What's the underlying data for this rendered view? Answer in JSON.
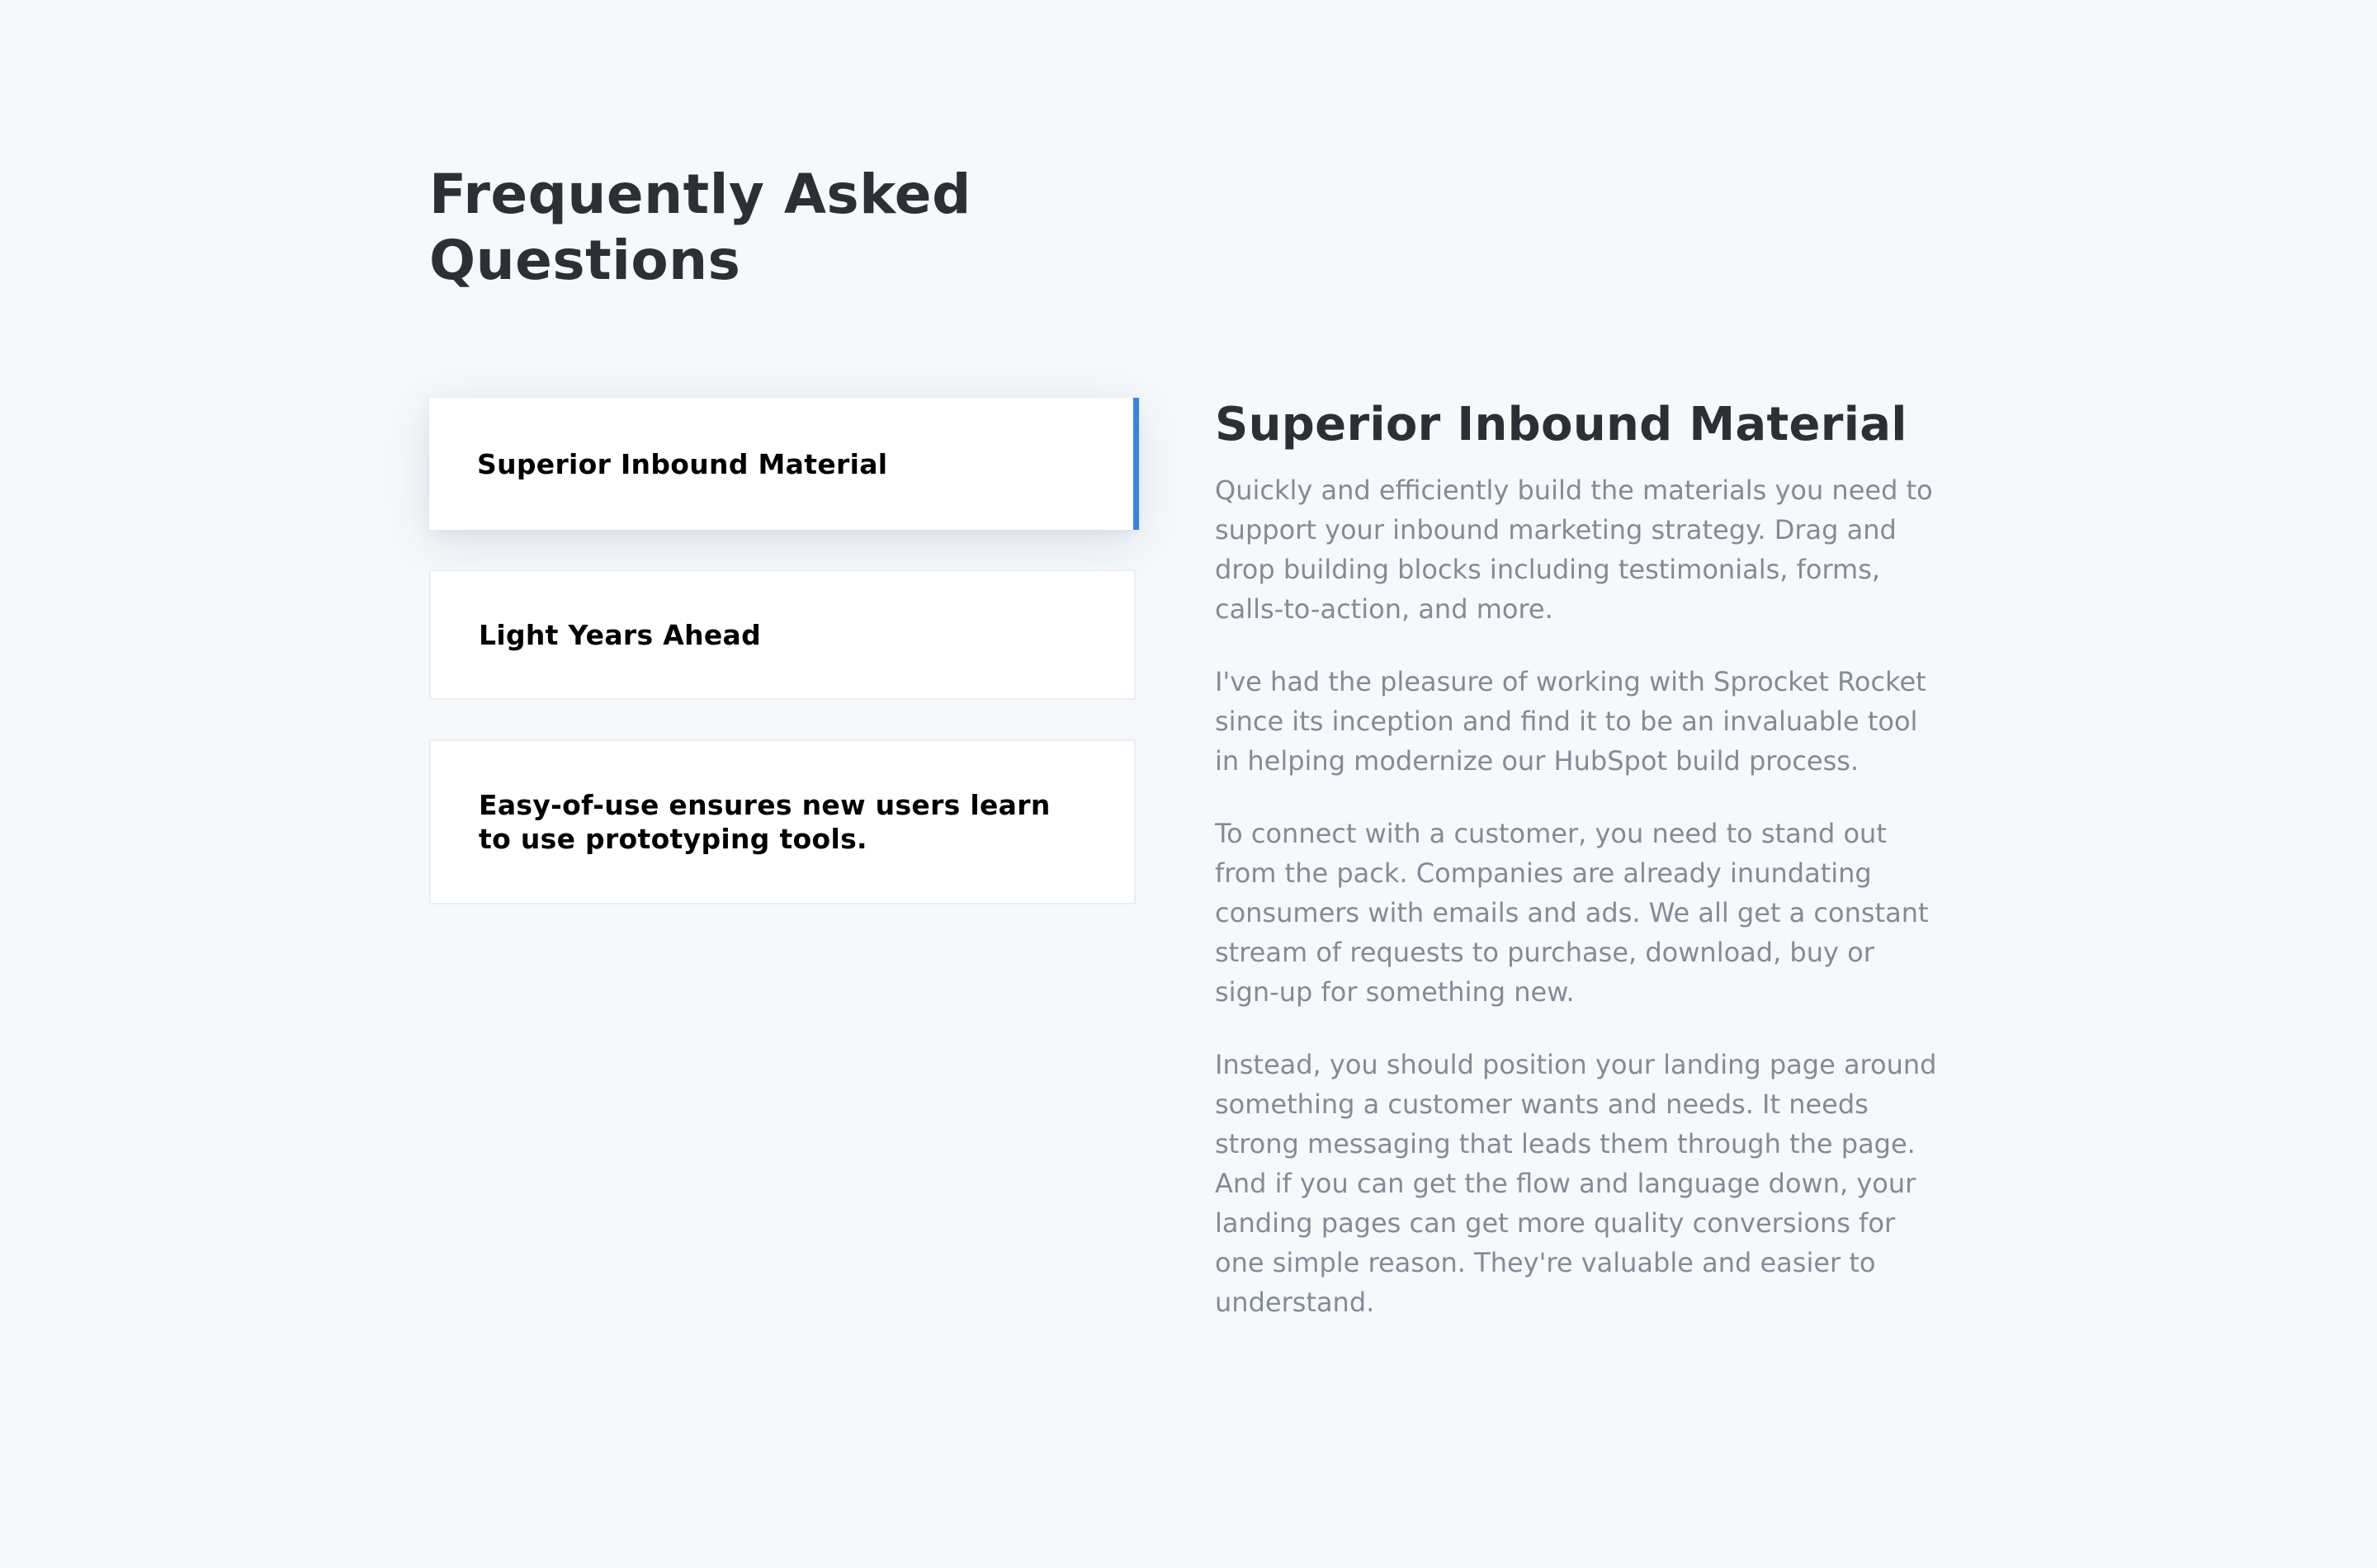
{
  "page": {
    "title": "Frequently Asked Questions"
  },
  "tabs": [
    {
      "label": "Superior Inbound Material",
      "active": true
    },
    {
      "label": "Light Years Ahead",
      "active": false
    },
    {
      "label": "Easy-of-use ensures new users learn to use prototyping tools.",
      "active": false
    }
  ],
  "panel": {
    "heading": "Superior Inbound Material",
    "paragraphs": [
      "Quickly and efficiently build the materials you need to support your inbound marketing strategy. Drag and drop building blocks including testimonials, forms, calls-to-action, and more.",
      "I've had the pleasure of working with Sprocket Rocket since its inception and find it to be an invaluable tool in helping modernize our HubSpot build process.",
      "To connect with a customer, you need to stand out from the pack. Companies are already inundating consumers with emails and ads. We all get a constant stream of requests to purchase, download, buy or sign-up for something new.",
      "Instead, you should position your landing page around something a customer wants and needs. It needs strong messaging that leads them through the page. And if you can get the flow and language down, your landing pages can get more quality conversions for one simple reason. They're valuable and easier to understand."
    ]
  },
  "colors": {
    "background": "#f5f9fc",
    "accent": "#3c82e0",
    "heading": "#2b3036",
    "body_text": "#848b97"
  }
}
